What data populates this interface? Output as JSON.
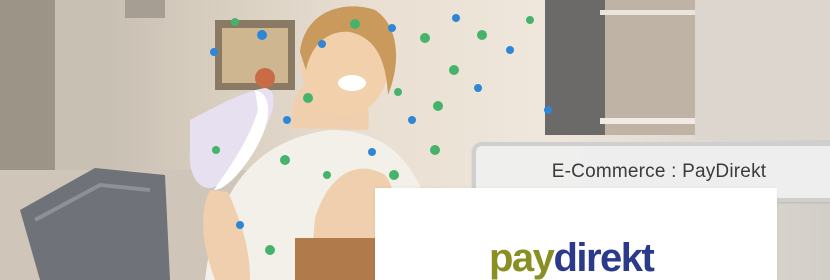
{
  "banner": {
    "caption": "E-Commerce : PayDirekt",
    "logo_part_1": "pay",
    "logo_part_2": "direkt"
  },
  "colors": {
    "logo_pay": "#8a8f24",
    "logo_direkt": "#2b3a8a",
    "caption_bg": "#eeeeee",
    "caption_border": "#cfcfcf",
    "confetti_green": "#46b36b",
    "confetti_blue": "#2f86d6"
  },
  "icons": [
    "confetti",
    "sneaker",
    "sofa-blanket",
    "paydirekt-logo"
  ]
}
